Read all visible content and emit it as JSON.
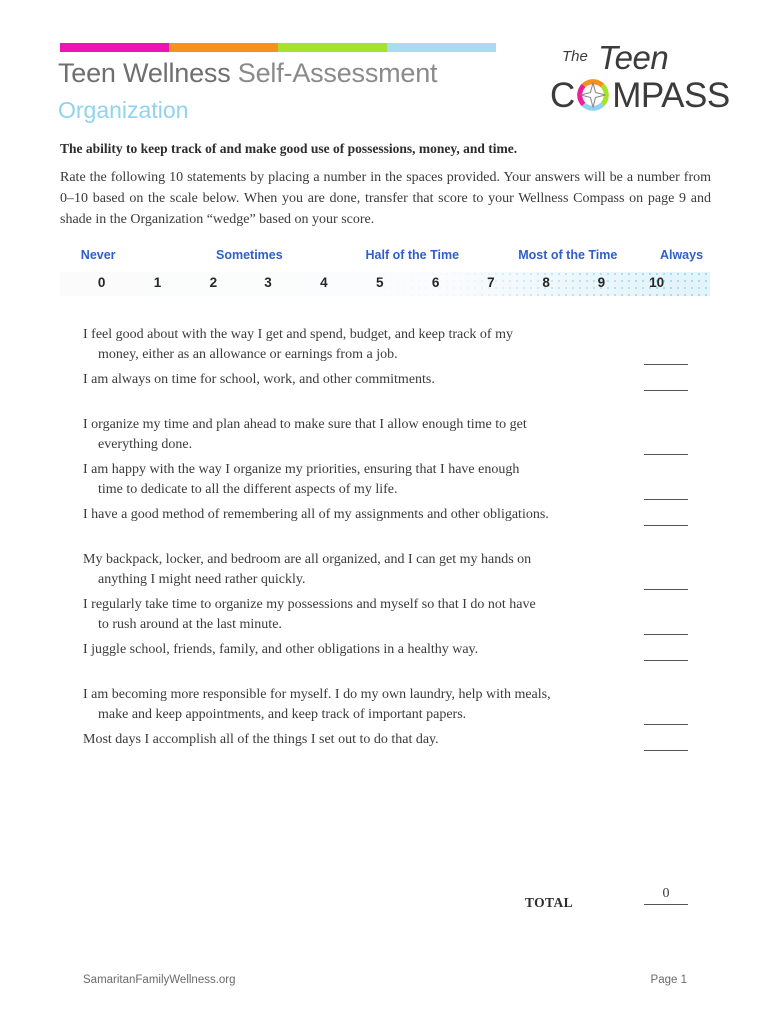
{
  "header": {
    "title_part1": "Teen Wellness ",
    "title_part2": "Self-Assessment",
    "subtitle": "Organization",
    "colorbar": [
      "#f112b4",
      "#f6911e",
      "#a4e32a",
      "#a8dcf2"
    ]
  },
  "logo": {
    "the": "The",
    "teen": "Teen",
    "c": "C",
    "mpass": "MPASS",
    "ring_colors": {
      "top_left": "#ec1e9c",
      "top_right": "#f6911e",
      "bottom_right": "#a4e32a",
      "bottom_left": "#8fd3ef"
    }
  },
  "body": {
    "lead": "The ability to keep track of and make good use of possessions, money, and time.",
    "intro": "Rate the following 10 statements by placing a number in the spaces provided. Your answers will be a number from 0–10 based on the scale below. When you are done, transfer that score to your Wellness Compass on page 9 and shade in the Organization “wedge” based on your score."
  },
  "scale": {
    "label_color": "#2f5fc9",
    "labels": [
      {
        "text": "Never",
        "left_pct": 3.2
      },
      {
        "text": "Sometimes",
        "left_pct": 24.0
      },
      {
        "text": "Half of the Time",
        "left_pct": 47.0
      },
      {
        "text": "Most of the Time",
        "left_pct": 70.5
      },
      {
        "text": "Always",
        "left_pct": 92.3
      }
    ],
    "numbers": [
      {
        "text": "0",
        "left_pct": 6.4
      },
      {
        "text": "1",
        "left_pct": 15.0
      },
      {
        "text": "2",
        "left_pct": 23.6
      },
      {
        "text": "3",
        "left_pct": 32.0
      },
      {
        "text": "4",
        "left_pct": 40.6
      },
      {
        "text": "5",
        "left_pct": 49.2
      },
      {
        "text": "6",
        "left_pct": 57.8
      },
      {
        "text": "7",
        "left_pct": 66.3
      },
      {
        "text": "8",
        "left_pct": 74.8
      },
      {
        "text": "9",
        "left_pct": 83.3
      },
      {
        "text": "10",
        "left_pct": 91.8
      }
    ]
  },
  "statements": [
    {
      "line1": "I feel good about with the way I get and spend, budget, and keep track of my",
      "line2": "money, either as an allowance or earnings from a job.",
      "answer": ""
    },
    {
      "line1": "I am always on time for school, work, and other commitments.",
      "line2": "",
      "answer": ""
    },
    {
      "line1": "I organize my time and plan ahead to make sure that I allow enough time to get",
      "line2": "everything done.",
      "answer": ""
    },
    {
      "line1": "I am happy with the way I organize my priorities, ensuring that I have enough",
      "line2": "time to dedicate to all the different aspects of my life.",
      "answer": ""
    },
    {
      "line1": "I have a good method of remembering all of my assignments and other obligations.",
      "line2": "",
      "answer": ""
    },
    {
      "line1": "My backpack, locker, and bedroom are all organized, and I can get my hands on",
      "line2": "anything I might need rather quickly.",
      "answer": ""
    },
    {
      "line1": "I regularly take time to organize my possessions and myself so that I do not have",
      "line2": "to rush around at the last minute.",
      "answer": ""
    },
    {
      "line1": "I juggle school, friends, family, and other obligations in a healthy way.",
      "line2": "",
      "answer": ""
    },
    {
      "line1": "I am becoming more responsible for myself. I do my own laundry, help with meals,",
      "line2": "make and keep appointments, and keep track of important papers.",
      "answer": ""
    },
    {
      "line1": "Most days I accomplish all of the things I set out to do that day.",
      "line2": "",
      "answer": ""
    }
  ],
  "total": {
    "label": "TOTAL",
    "value": "0"
  },
  "footer": {
    "site": "SamaritanFamilyWellness.org",
    "page": "Page 1"
  }
}
